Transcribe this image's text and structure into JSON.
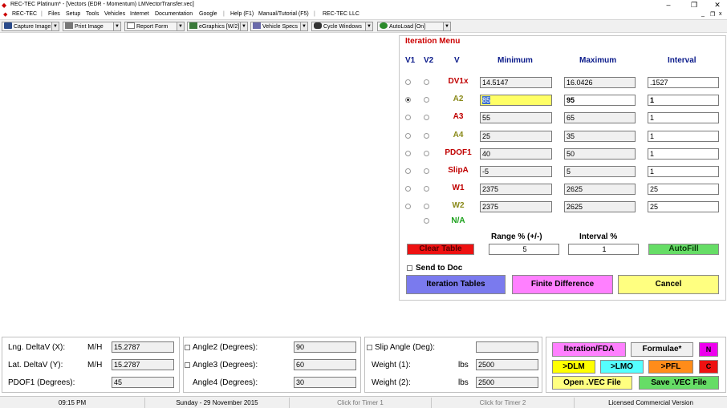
{
  "window": {
    "title": "REC-TEC Platinum* - [Vectors (EDR - Momentum)  LMVectorTransfer.vec]",
    "minimize": "–",
    "restore": "❐",
    "close": "✕",
    "mdi_min": "_",
    "mdi_restore": "❐",
    "mdi_close": "x"
  },
  "menu": {
    "items": [
      "REC-TEC",
      "Files",
      "Setup",
      "Tools",
      "Vehicles",
      "Internet",
      "Documentation",
      "Google",
      "Help (F1)",
      "Manual/Tutorial (F5)",
      "REC-TEC LLC"
    ],
    "separators": [
      "|",
      "|",
      "|"
    ]
  },
  "toolbar": {
    "buttons": [
      {
        "label": "Capture Image",
        "icon": "camera-icon"
      },
      {
        "label": "Print Image",
        "icon": "printer-icon"
      },
      {
        "label": "Report Form",
        "icon": "report-icon"
      },
      {
        "label": "eGraphics [W/2]",
        "icon": "egraphics-icon"
      },
      {
        "label": "Vehicle Specs",
        "icon": "vehicle-specs-icon"
      },
      {
        "label": "Cycle Windows",
        "icon": "binoculars-icon"
      },
      {
        "label": "AutoLoad [On]",
        "icon": "autoload-icon"
      }
    ]
  },
  "iteration": {
    "title": "Iteration Menu",
    "headers": {
      "v1": "V1",
      "v2": "V2",
      "v": "V",
      "min": "Minimum",
      "max": "Maximum",
      "interval": "Interval"
    },
    "rows": [
      {
        "name": "DV1x",
        "color": "#c00000",
        "min": "14.5147",
        "max": "16.0426",
        "interval": ".1527",
        "v1_selected": false
      },
      {
        "name": "A2",
        "color": "#8a8a1a",
        "min": "85",
        "max": "95",
        "interval": "1",
        "v1_selected": true
      },
      {
        "name": "A3",
        "color": "#c00000",
        "min": "55",
        "max": "65",
        "interval": "1",
        "v1_selected": false
      },
      {
        "name": "A4",
        "color": "#8a8a1a",
        "min": "25",
        "max": "35",
        "interval": "1",
        "v1_selected": false
      },
      {
        "name": "PDOF1",
        "color": "#c00000",
        "min": "40",
        "max": "50",
        "interval": "1",
        "v1_selected": false
      },
      {
        "name": "SlipA",
        "color": "#c00000",
        "min": "-5",
        "max": "5",
        "interval": "1",
        "v1_selected": false
      },
      {
        "name": "W1",
        "color": "#c00000",
        "min": "2375",
        "max": "2625",
        "interval": "25",
        "v1_selected": false
      },
      {
        "name": "W2",
        "color": "#8a8a1a",
        "min": "2375",
        "max": "2625",
        "interval": "25",
        "v1_selected": false
      }
    ],
    "na_label": "N/A",
    "na_color": "#1aa01a",
    "range_label": "Range % (+/-)",
    "range_value": "5",
    "interval_pct_label": "Interval %",
    "interval_pct_value": "1",
    "clear_table": "Clear Table",
    "autofill": "AutoFill",
    "send_to_doc": "Send to Doc",
    "iteration_tables": "Iteration Tables",
    "finite_difference": "Finite Difference",
    "cancel": "Cancel"
  },
  "bottom": {
    "lng_label": "Lng. DeltaV (X):",
    "lng_unit": "M/H",
    "lng_value": "15.2787",
    "lat_label": "Lat. DeltaV (Y):",
    "lat_unit": "M/H",
    "lat_value": "15.2787",
    "pdof_label": "PDOF1 (Degrees):",
    "pdof_value": "45",
    "angle2_label": "Angle2 (Degrees):",
    "angle2_value": "90",
    "angle3_label": "Angle3 (Degrees):",
    "angle3_value": "60",
    "angle4_label": "Angle4 (Degrees):",
    "angle4_value": "30",
    "slip_label": "Slip Angle (Deg):",
    "slip_value": "",
    "w1_label": "Weight (1):",
    "w1_unit": "lbs",
    "w1_value": "2500",
    "w2_label": "Weight (2):",
    "w2_unit": "lbs",
    "w2_value": "2500",
    "iteration_fda": "Iteration/FDA",
    "formulae": "Formulae*",
    "n_btn": "N",
    "dlm": ">DLM",
    "lmo": ">LMO",
    "pfl": ">PFL",
    "c_btn": "C",
    "open_vec": "Open .VEC File",
    "save_vec": "Save .VEC File"
  },
  "status": {
    "time": "09:15 PM",
    "date": "Sunday  -  29 November 2015",
    "timer1": "Click for Timer 1",
    "timer2": "Click for Timer 2",
    "license": "Licensed Commercial Version"
  }
}
